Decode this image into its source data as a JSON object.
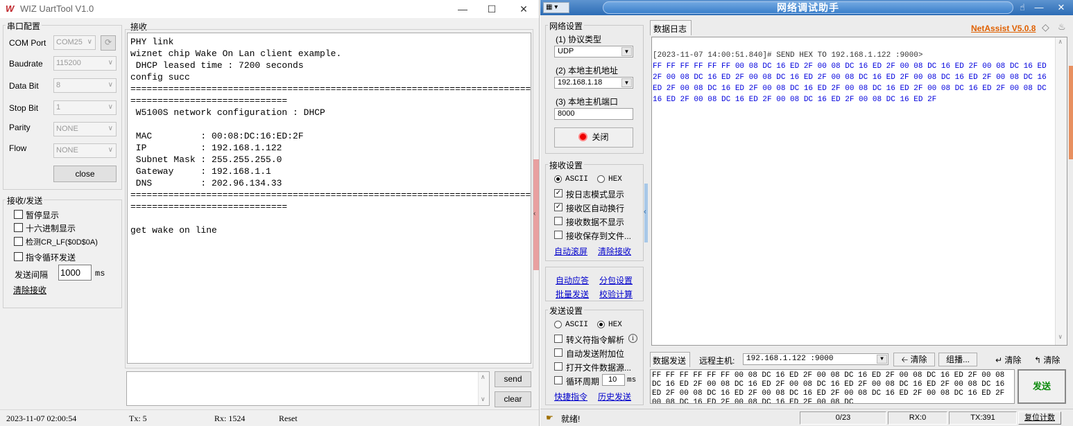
{
  "uart": {
    "title": "WIZ UartTool V1.0",
    "serial_group": "串口配置",
    "com_port_label": "COM Port",
    "com_port_value": "COM25",
    "baudrate_label": "Baudrate",
    "baudrate_value": "115200",
    "databit_label": "Data Bit",
    "databit_value": "8",
    "stopbit_label": "Stop Bit",
    "stopbit_value": "1",
    "parity_label": "Parity",
    "parity_value": "NONE",
    "flow_label": "Flow",
    "flow_value": "NONE",
    "close_btn": "close",
    "rxtx_group": "接收/发送",
    "opt_pause": "暂停显示",
    "opt_hex": "十六进制显示",
    "opt_crlf": "检测CR_LF($0D$0A)",
    "opt_loop": "指令循环发送",
    "interval_label": "发送间隔",
    "interval_value": "1000",
    "interval_unit": "ms",
    "clear_rx": "清除接收",
    "recv_group": "接收",
    "terminal_text": "PHY link\nwiznet chip Wake On Lan client example.\n DHCP leased time : 7200 seconds\nconfig succ\n==========================================================================\n=============================\n W5100S network configuration : DHCP\n\n MAC         : 00:08:DC:16:ED:2F\n IP          : 192.168.1.122\n Subnet Mask : 255.255.255.0\n Gateway     : 192.168.1.1\n DNS         : 202.96.134.33\n==========================================================================\n=============================\n\nget wake on line",
    "send_btn": "send",
    "clear_btn": "clear",
    "status_time": "2023-11-07 02:00:54",
    "status_tx": "Tx: 5",
    "status_rx": "Rx: 1524",
    "status_reset": "Reset"
  },
  "net": {
    "title": "网络调试助手",
    "net_group": "网络设置",
    "proto_label": "(1) 协议类型",
    "proto_value": "UDP",
    "host_label": "(2) 本地主机地址",
    "host_value": "192.168.1.18",
    "port_label": "(3) 本地主机端口",
    "port_value": "8000",
    "close_btn": "关闭",
    "recv_group": "接收设置",
    "recv_ascii": "ASCII",
    "recv_hex": "HEX",
    "opt_logmode": "按日志模式显示",
    "opt_autowrap": "接收区自动换行",
    "opt_nodisplay": "接收数据不显示",
    "opt_savefile": "接收保存到文件...",
    "link_autoscroll": "自动滚屏",
    "link_clearrecv": "清除接收",
    "link_autoreply": "自动应答",
    "link_packet": "分包设置",
    "link_batch": "批量发送",
    "link_checksum": "校验计算",
    "send_group": "发送设置",
    "send_ascii": "ASCII",
    "send_hex": "HEX",
    "opt_escape": "转义符指令解析",
    "opt_autoadd": "自动发送附加位",
    "opt_openfile": "打开文件数据源...",
    "opt_cycle": "循环周期",
    "cycle_value": "10",
    "cycle_unit": "ms",
    "link_shortcut": "快捷指令",
    "link_history": "历史发送",
    "log_tab": "数据日志",
    "brand": "NetAssist V5.0.8",
    "log_timestamp": "[2023-11-07 14:00:51.840]# SEND HEX TO 192.168.1.122 :9000>",
    "log_hex": "FF FF FF FF FF FF 00 08 DC 16 ED 2F 00 08 DC 16 ED 2F 00 08 DC 16 ED 2F 00 08 DC 16 ED 2F 00 08 DC 16 ED 2F 00 08 DC 16 ED 2F 00 08 DC 16 ED 2F 00 08 DC 16 ED 2F 00 08 DC 16 ED 2F 00 08 DC 16 ED 2F 00 08 DC 16 ED 2F 00 08 DC 16 ED 2F 00 08 DC 16 ED 2F 00 08 DC 16 ED 2F 00 08 DC 16 ED 2F 00 08 DC 16 ED 2F 00 08 DC 16 ED 2F",
    "send_tab": "数据发送",
    "remote_label": "远程主机:",
    "remote_value": "192.168.1.122 :9000",
    "btn_clear1": "清除",
    "btn_group": "组播...",
    "btn_clear2": "清除",
    "btn_clear3": "清除",
    "send_text": "FF FF FF FF FF FF 00 08 DC 16 ED 2F 00 08 DC 16 ED 2F 00 08 DC 16 ED 2F 00 08 DC 16 ED 2F 00 08 DC 16 ED 2F 00 08 DC 16 ED 2F 00 08 DC 16 ED 2F 00 08 DC 16 ED 2F 00 08 DC 16 ED 2F 00 08 DC 16 ED 2F 00 08 DC 16 ED 2F 00 08 DC 16 ED 2F 00 08 DC 16 ED 2F 00 08 DC 16 ED 2F 00 08 DC",
    "send_btn": "发送",
    "status_ready": "就绪!",
    "status_count": "0/23",
    "status_rx": "RX:0",
    "status_tx": "TX:391",
    "status_reset": "复位计数"
  }
}
